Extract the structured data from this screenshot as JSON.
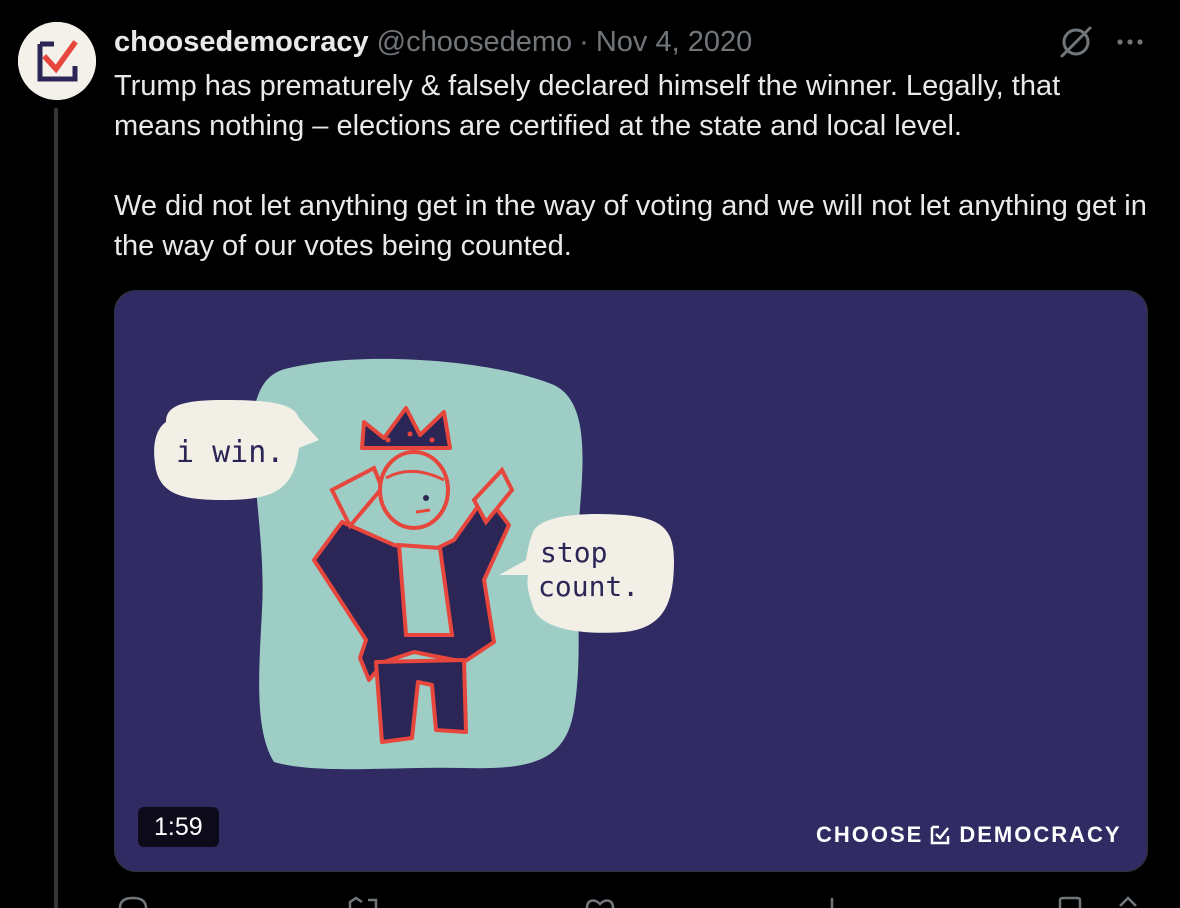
{
  "tweet": {
    "author": {
      "name": "choosedemocracy",
      "handle": "@choosedemo",
      "avatar_icon": "choose-democracy-logo-icon"
    },
    "separator": "·",
    "date": "Nov 4, 2020",
    "text": "Trump has prematurely & falsely declared himself the winner. Legally, that means nothing – elections are certified at the state and local level.\n\nWe did not let anything get in the way of voting and we will not let anything get in the way of our votes being counted.",
    "media": {
      "type": "video",
      "duration": "1:59",
      "bubble_left": "i win.",
      "bubble_right_line1": "stop",
      "bubble_right_line2": "count.",
      "watermark_left": "CHOOSE",
      "watermark_right": "DEMOCRACY",
      "background_color": "#302b63"
    },
    "icons": [
      "grok-icon",
      "more-icon",
      "reply-icon",
      "retweet-icon",
      "like-icon",
      "views-icon",
      "bookmark-icon",
      "share-icon"
    ]
  },
  "colors": {
    "background": "#000000",
    "text_primary": "#e7e9ea",
    "text_secondary": "#71767b",
    "brand_red": "#e6463c",
    "brand_navy": "#2b2656"
  }
}
